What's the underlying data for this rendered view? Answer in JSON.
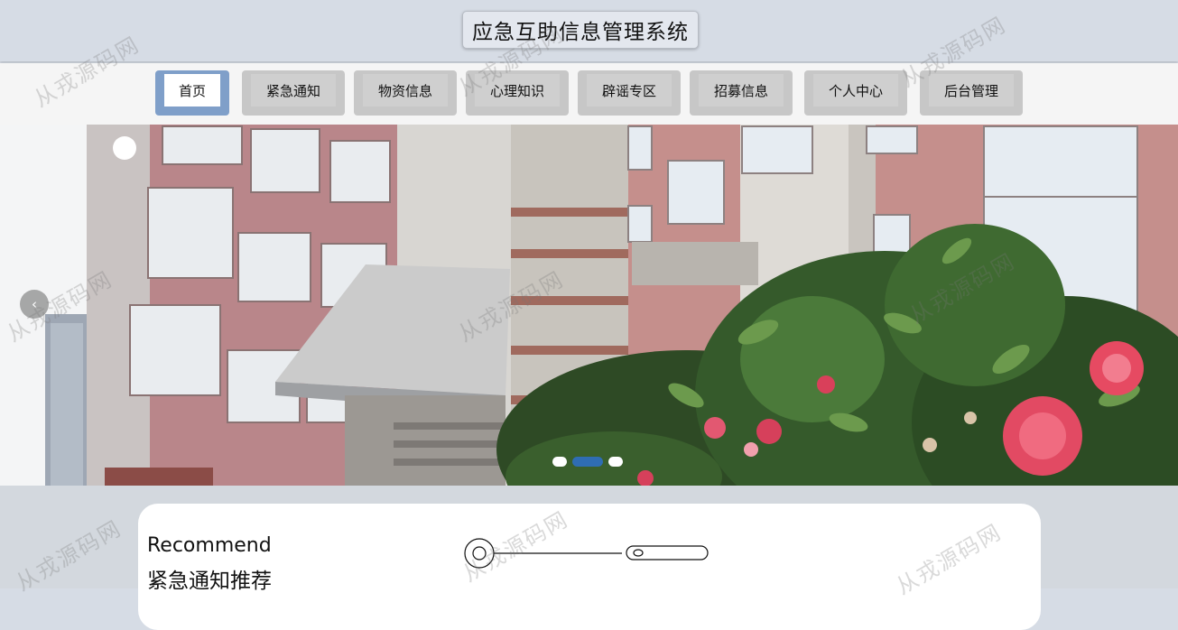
{
  "header": {
    "title": "应急互助信息管理系统"
  },
  "nav": {
    "items": [
      {
        "label": "首页",
        "active": true
      },
      {
        "label": "紧急通知",
        "active": false
      },
      {
        "label": "物资信息",
        "active": false
      },
      {
        "label": "心理知识",
        "active": false
      },
      {
        "label": "辟谣专区",
        "active": false
      },
      {
        "label": "招募信息",
        "active": false
      },
      {
        "label": "个人中心",
        "active": false
      },
      {
        "label": "后台管理",
        "active": false
      }
    ]
  },
  "banner": {
    "prev_icon": "chevron-left-icon",
    "prev_glyph": "‹",
    "slide_count": 3,
    "active_slide": 2
  },
  "recommend": {
    "title_en": "Recommend",
    "title_cn": "紧急通知推荐"
  },
  "watermark": {
    "text": "从戎源码网"
  },
  "colors": {
    "header_bg": "#d6dce5",
    "nav_active_border": "#7f9fc9",
    "nav_item_bg": "#c7c7c7",
    "indicator_active": "#2f6db3"
  }
}
